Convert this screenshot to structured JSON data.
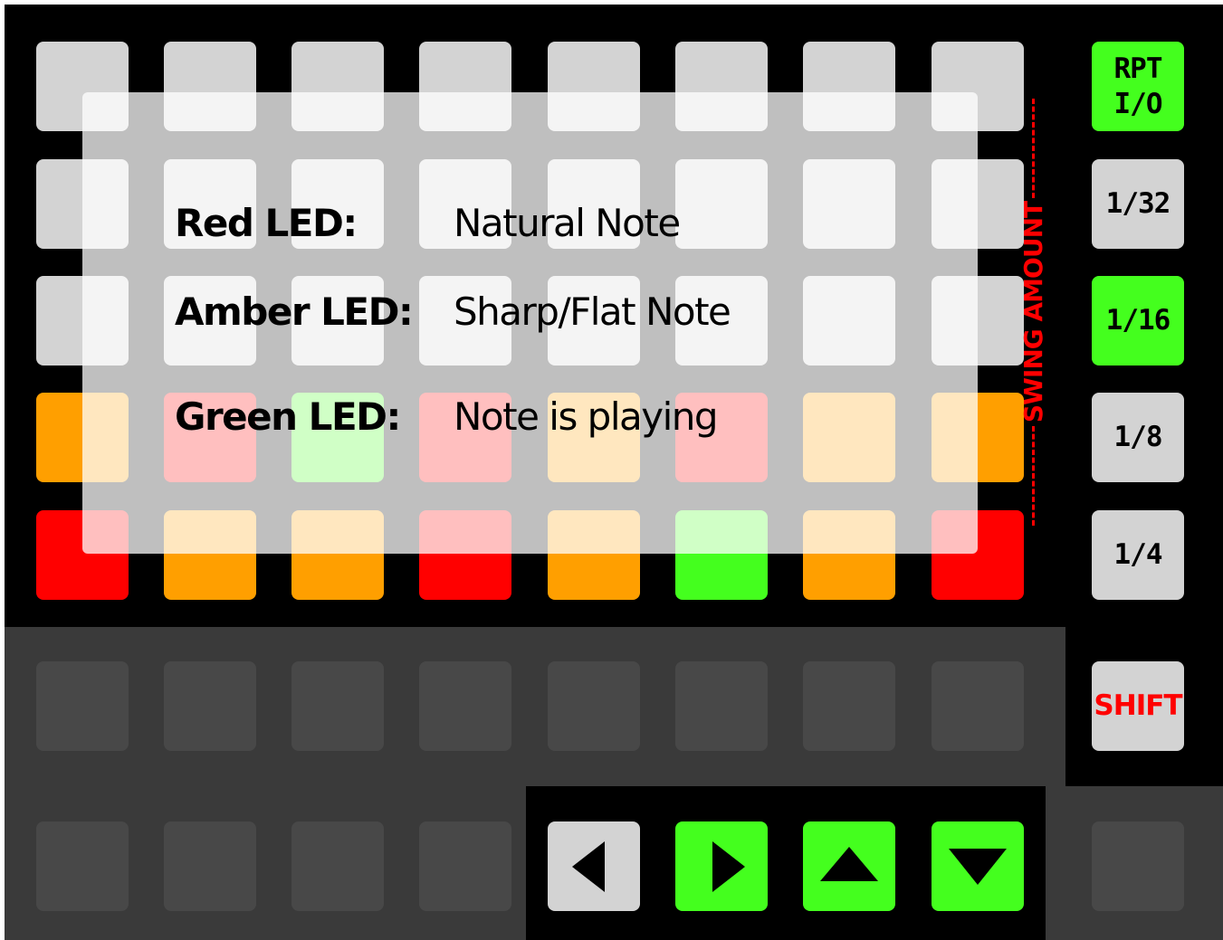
{
  "legend": {
    "rows": [
      {
        "label": "Red LED:",
        "value": "Natural Note"
      },
      {
        "label": "Amber LED:",
        "value": "Sharp/Flat Note"
      },
      {
        "label": "Green LED:",
        "value": "Note is playing"
      }
    ]
  },
  "side_buttons": [
    {
      "label": "RPT\nI/O",
      "color": "#44ff1e"
    },
    {
      "label": "1/32",
      "color": "#d3d3d3"
    },
    {
      "label": "1/16",
      "color": "#44ff1e"
    },
    {
      "label": "1/8",
      "color": "#d3d3d3"
    },
    {
      "label": "1/4",
      "color": "#d3d3d3"
    }
  ],
  "shift_label": "SHIFT",
  "swing_label": "SWING AMOUNT",
  "grid_rows": [
    [
      "off",
      "off",
      "off",
      "off",
      "off",
      "off",
      "off",
      "off"
    ],
    [
      "off",
      "off",
      "off",
      "off",
      "off",
      "off",
      "off",
      "off"
    ],
    [
      "off",
      "off",
      "off",
      "off",
      "off",
      "off",
      "off",
      "off"
    ],
    [
      "orange",
      "red",
      "green",
      "red",
      "orange",
      "red",
      "orange",
      "orange"
    ],
    [
      "red",
      "orange",
      "orange",
      "red",
      "orange",
      "green",
      "orange",
      "red"
    ]
  ],
  "nav_arrows": [
    {
      "name": "left-arrow-icon",
      "direction": "left",
      "color": "#d3d3d3"
    },
    {
      "name": "right-arrow-icon",
      "direction": "right",
      "color": "#44ff1e"
    },
    {
      "name": "up-arrow-icon",
      "direction": "up",
      "color": "#44ff1e"
    },
    {
      "name": "down-arrow-icon",
      "direction": "down",
      "color": "#44ff1e"
    }
  ],
  "colors": {
    "off": "#d3d3d3",
    "orange": "#ff9f00",
    "red": "#ff0000",
    "green": "#44ff1e",
    "dark": "#484848",
    "background": "#000000",
    "panel": "#3a3a3a"
  }
}
